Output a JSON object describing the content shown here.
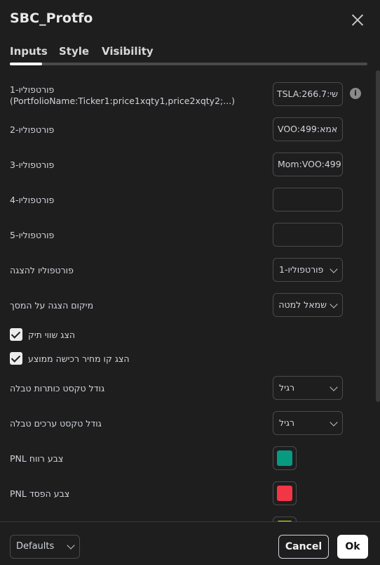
{
  "dialog": {
    "title": "SBC_Protfo"
  },
  "tabs": [
    {
      "label": "Inputs",
      "active": true
    },
    {
      "label": "Style",
      "active": false
    },
    {
      "label": "Visibility",
      "active": false
    }
  ],
  "inputs": {
    "portfolio1": {
      "label": "פורטפוליו-1",
      "hint": "(PortfolioName:Ticker1:price1xqty1,price2xqty2;...)",
      "value": "שי:TSLA:266.7",
      "info_icon": "info-icon"
    },
    "portfolio2": {
      "label": "פורטפוליו-2",
      "value": "אמא:VOO:499"
    },
    "portfolio3": {
      "label": "פורטפוליו-3",
      "value": "Mom:VOO:499"
    },
    "portfolio4": {
      "label": "פורטפוליו-4",
      "value": ""
    },
    "portfolio5": {
      "label": "פורטפוליו-5",
      "value": ""
    },
    "display_portfolio": {
      "label": "פורטפוליו להצגה",
      "value": "פורטפוליו-1"
    },
    "screen_position": {
      "label": "מיקום הצגה על המסך",
      "value": "שמאל למטה"
    },
    "show_portfolio_value": {
      "label": "הצג שווי תיק",
      "checked": true
    },
    "show_avg_price_line": {
      "label": "הצג קו מחיר רכישה ממוצע",
      "checked": true
    },
    "header_text_size": {
      "label": "גודל טקסט כותרות טבלה",
      "value": "רגיל"
    },
    "values_text_size": {
      "label": "גודל טקסט ערכים טבלה",
      "value": "רגיל"
    },
    "pnl_profit_color": {
      "label": "PNL צבע רווח",
      "color": "#089981"
    },
    "pnl_loss_color": {
      "label": "PNL צבע הפסד",
      "color": "#f23645"
    },
    "next_color": {
      "color": "#e5e51a"
    }
  },
  "footer": {
    "defaults_label": "Defaults",
    "cancel_label": "Cancel",
    "ok_label": "Ok"
  }
}
